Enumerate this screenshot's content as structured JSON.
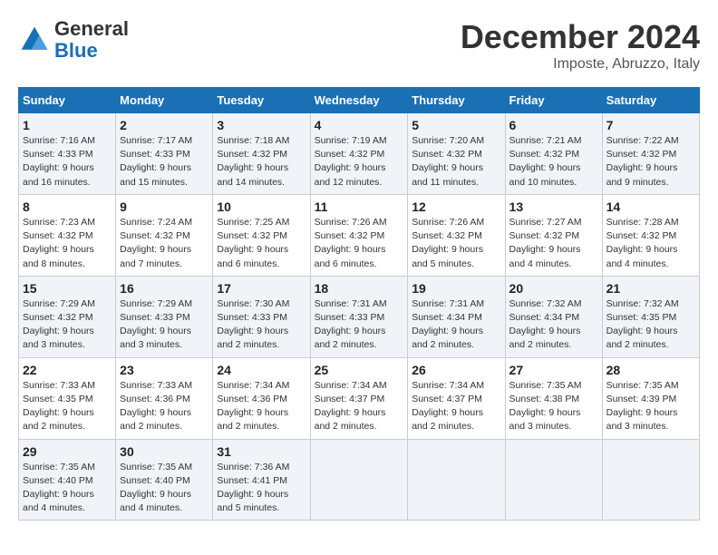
{
  "header": {
    "logo_line1": "General",
    "logo_line2": "Blue",
    "month": "December 2024",
    "location": "Imposte, Abruzzo, Italy"
  },
  "weekdays": [
    "Sunday",
    "Monday",
    "Tuesday",
    "Wednesday",
    "Thursday",
    "Friday",
    "Saturday"
  ],
  "weeks": [
    [
      {
        "day": 1,
        "sunrise": "7:16 AM",
        "sunset": "4:33 PM",
        "daylight": "9 hours and 16 minutes."
      },
      {
        "day": 2,
        "sunrise": "7:17 AM",
        "sunset": "4:33 PM",
        "daylight": "9 hours and 15 minutes."
      },
      {
        "day": 3,
        "sunrise": "7:18 AM",
        "sunset": "4:32 PM",
        "daylight": "9 hours and 14 minutes."
      },
      {
        "day": 4,
        "sunrise": "7:19 AM",
        "sunset": "4:32 PM",
        "daylight": "9 hours and 12 minutes."
      },
      {
        "day": 5,
        "sunrise": "7:20 AM",
        "sunset": "4:32 PM",
        "daylight": "9 hours and 11 minutes."
      },
      {
        "day": 6,
        "sunrise": "7:21 AM",
        "sunset": "4:32 PM",
        "daylight": "9 hours and 10 minutes."
      },
      {
        "day": 7,
        "sunrise": "7:22 AM",
        "sunset": "4:32 PM",
        "daylight": "9 hours and 9 minutes."
      }
    ],
    [
      {
        "day": 8,
        "sunrise": "7:23 AM",
        "sunset": "4:32 PM",
        "daylight": "9 hours and 8 minutes."
      },
      {
        "day": 9,
        "sunrise": "7:24 AM",
        "sunset": "4:32 PM",
        "daylight": "9 hours and 7 minutes."
      },
      {
        "day": 10,
        "sunrise": "7:25 AM",
        "sunset": "4:32 PM",
        "daylight": "9 hours and 6 minutes."
      },
      {
        "day": 11,
        "sunrise": "7:26 AM",
        "sunset": "4:32 PM",
        "daylight": "9 hours and 6 minutes."
      },
      {
        "day": 12,
        "sunrise": "7:26 AM",
        "sunset": "4:32 PM",
        "daylight": "9 hours and 5 minutes."
      },
      {
        "day": 13,
        "sunrise": "7:27 AM",
        "sunset": "4:32 PM",
        "daylight": "9 hours and 4 minutes."
      },
      {
        "day": 14,
        "sunrise": "7:28 AM",
        "sunset": "4:32 PM",
        "daylight": "9 hours and 4 minutes."
      }
    ],
    [
      {
        "day": 15,
        "sunrise": "7:29 AM",
        "sunset": "4:32 PM",
        "daylight": "9 hours and 3 minutes."
      },
      {
        "day": 16,
        "sunrise": "7:29 AM",
        "sunset": "4:33 PM",
        "daylight": "9 hours and 3 minutes."
      },
      {
        "day": 17,
        "sunrise": "7:30 AM",
        "sunset": "4:33 PM",
        "daylight": "9 hours and 2 minutes."
      },
      {
        "day": 18,
        "sunrise": "7:31 AM",
        "sunset": "4:33 PM",
        "daylight": "9 hours and 2 minutes."
      },
      {
        "day": 19,
        "sunrise": "7:31 AM",
        "sunset": "4:34 PM",
        "daylight": "9 hours and 2 minutes."
      },
      {
        "day": 20,
        "sunrise": "7:32 AM",
        "sunset": "4:34 PM",
        "daylight": "9 hours and 2 minutes."
      },
      {
        "day": 21,
        "sunrise": "7:32 AM",
        "sunset": "4:35 PM",
        "daylight": "9 hours and 2 minutes."
      }
    ],
    [
      {
        "day": 22,
        "sunrise": "7:33 AM",
        "sunset": "4:35 PM",
        "daylight": "9 hours and 2 minutes."
      },
      {
        "day": 23,
        "sunrise": "7:33 AM",
        "sunset": "4:36 PM",
        "daylight": "9 hours and 2 minutes."
      },
      {
        "day": 24,
        "sunrise": "7:34 AM",
        "sunset": "4:36 PM",
        "daylight": "9 hours and 2 minutes."
      },
      {
        "day": 25,
        "sunrise": "7:34 AM",
        "sunset": "4:37 PM",
        "daylight": "9 hours and 2 minutes."
      },
      {
        "day": 26,
        "sunrise": "7:34 AM",
        "sunset": "4:37 PM",
        "daylight": "9 hours and 2 minutes."
      },
      {
        "day": 27,
        "sunrise": "7:35 AM",
        "sunset": "4:38 PM",
        "daylight": "9 hours and 3 minutes."
      },
      {
        "day": 28,
        "sunrise": "7:35 AM",
        "sunset": "4:39 PM",
        "daylight": "9 hours and 3 minutes."
      }
    ],
    [
      {
        "day": 29,
        "sunrise": "7:35 AM",
        "sunset": "4:40 PM",
        "daylight": "9 hours and 4 minutes."
      },
      {
        "day": 30,
        "sunrise": "7:35 AM",
        "sunset": "4:40 PM",
        "daylight": "9 hours and 4 minutes."
      },
      {
        "day": 31,
        "sunrise": "7:36 AM",
        "sunset": "4:41 PM",
        "daylight": "9 hours and 5 minutes."
      },
      null,
      null,
      null,
      null
    ]
  ]
}
